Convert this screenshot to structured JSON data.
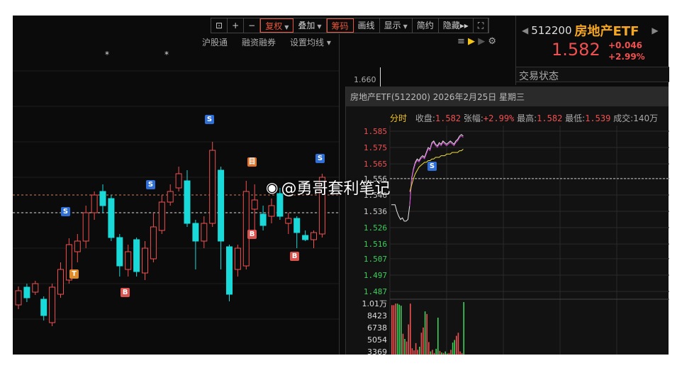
{
  "toolbar": {
    "items": [
      {
        "label": "复权",
        "red": true,
        "caret": true
      },
      {
        "label": "叠加",
        "caret": true
      },
      {
        "label": "筹码",
        "red": true
      },
      {
        "label": "画线"
      },
      {
        "label": "显示",
        "caret": true
      },
      {
        "label": "简约"
      },
      {
        "label": "隐藏▸▸"
      }
    ]
  },
  "subbar": [
    "沪股通",
    "融资融券",
    "设置均线 ▾"
  ],
  "stock": {
    "code": "512200",
    "name": "房地产ETF",
    "price": "1.582",
    "change": "+0.046",
    "change_pct": "+2.99%",
    "trade_status": "交易状态"
  },
  "left_axis_label": "1.660",
  "markers": {
    "s": "S",
    "b": "B",
    "t": "T",
    "m": "目",
    "star": "*"
  },
  "colors": {
    "up": "#f05050",
    "down": "#19d9d9",
    "bg": "#0b0b0b",
    "accent": "#f5a623"
  },
  "chart_data": [
    {
      "type": "candlestick",
      "title": "房地产ETF 日K",
      "ohlc": [
        [
          1.426,
          1.446,
          1.452,
          1.42
        ],
        [
          1.451,
          1.436,
          1.456,
          1.43
        ],
        [
          1.444,
          1.456,
          1.46,
          1.44
        ],
        [
          1.434,
          1.411,
          1.438,
          1.404
        ],
        [
          1.401,
          1.451,
          1.456,
          1.396
        ],
        [
          1.441,
          1.476,
          1.486,
          1.436
        ],
        [
          1.461,
          1.511,
          1.52,
          1.456
        ],
        [
          1.501,
          1.516,
          1.526,
          1.486
        ],
        [
          1.516,
          1.556,
          1.566,
          1.506
        ],
        [
          1.556,
          1.581,
          1.586,
          1.546
        ],
        [
          1.586,
          1.566,
          1.596,
          1.556
        ],
        [
          1.576,
          1.521,
          1.581,
          1.516
        ],
        [
          1.521,
          1.481,
          1.526,
          1.466
        ],
        [
          1.476,
          1.501,
          1.511,
          1.466
        ],
        [
          1.518,
          1.473,
          1.521,
          1.466
        ],
        [
          1.471,
          1.506,
          1.516,
          1.461
        ],
        [
          1.491,
          1.536,
          1.556,
          1.486
        ],
        [
          1.531,
          1.571,
          1.581,
          1.526
        ],
        [
          1.571,
          1.586,
          1.596,
          1.566
        ],
        [
          1.591,
          1.611,
          1.621,
          1.586
        ],
        [
          1.601,
          1.541,
          1.616,
          1.536
        ],
        [
          1.541,
          1.516,
          1.546,
          1.476
        ],
        [
          1.516,
          1.541,
          1.551,
          1.506
        ],
        [
          1.541,
          1.644,
          1.656,
          1.536
        ],
        [
          1.616,
          1.516,
          1.621,
          1.476
        ],
        [
          1.508,
          1.441,
          1.511,
          1.431
        ],
        [
          1.476,
          1.506,
          1.511,
          1.466
        ],
        [
          1.481,
          1.586,
          1.601,
          1.476
        ],
        [
          1.561,
          1.574,
          1.596,
          1.531
        ],
        [
          1.554,
          1.538,
          1.566,
          1.531
        ],
        [
          1.551,
          1.566,
          1.576,
          1.541
        ],
        [
          1.583,
          1.551,
          1.591,
          1.546
        ],
        [
          1.541,
          1.548,
          1.556,
          1.526
        ],
        [
          1.548,
          1.528,
          1.551,
          1.506
        ],
        [
          1.524,
          1.518,
          1.531,
          1.516
        ],
        [
          1.518,
          1.528,
          1.531,
          1.506
        ],
        [
          1.526,
          1.606,
          1.611,
          1.521
        ]
      ],
      "reference_lines": [
        1.556,
        1.581
      ]
    },
    {
      "type": "line",
      "title": "房地产ETF(512200) 2026年2月25日 星期三",
      "tab": "分时",
      "stats": {
        "close_label": "收盘",
        "close": "1.582",
        "chg_label": "张幅",
        "chg": "+2.99%",
        "high_label": "最高",
        "high": "1.582",
        "low_label": "最低",
        "low": "1.539",
        "vol_label": "成交",
        "vol": "140万"
      },
      "yticks": [
        "1.585",
        "1.575",
        "1.565",
        "1.556",
        "1.546",
        "1.536",
        "1.526",
        "1.516",
        "1.507",
        "1.497",
        "1.487"
      ],
      "ylim": [
        1.487,
        1.585
      ],
      "prev_close": 1.556,
      "price": [
        1.54,
        1.54,
        1.54,
        1.536,
        1.533,
        1.531,
        1.532,
        1.53,
        1.53,
        1.531,
        1.54,
        1.556,
        1.562,
        1.566,
        1.568,
        1.567,
        1.569,
        1.57,
        1.569,
        1.572,
        1.575,
        1.574,
        1.578,
        1.579,
        1.577,
        1.576,
        1.578,
        1.577,
        1.579,
        1.578,
        1.577,
        1.578,
        1.579,
        1.578,
        1.577,
        1.579,
        1.58,
        1.582,
        1.583,
        1.582
      ],
      "avg": [
        null,
        null,
        null,
        null,
        null,
        null,
        null,
        null,
        null,
        null,
        1.548,
        1.552,
        1.556,
        1.559,
        1.561,
        1.563,
        1.564,
        1.565,
        1.566,
        1.566,
        1.567,
        1.567,
        1.568,
        1.568,
        1.569,
        1.569,
        1.569,
        1.57,
        1.57,
        1.57,
        1.571,
        1.571,
        1.571,
        1.572,
        1.572,
        1.572,
        1.572,
        1.573,
        1.573,
        1.574
      ],
      "volume_ticks": [
        "1.01万",
        "8423",
        "6738",
        "5054",
        "3369"
      ],
      "volume": [
        9500,
        9500,
        9800,
        9800,
        9600,
        9400,
        4000,
        3000,
        2500,
        5800,
        9800,
        1200,
        800,
        2200,
        900,
        1500,
        4200,
        5200,
        8300,
        7800,
        2400,
        600,
        900,
        300,
        1100,
        7100,
        700,
        400,
        300,
        600,
        200,
        300,
        900,
        2300,
        2800,
        3600,
        4200,
        600,
        300,
        10100
      ]
    }
  ],
  "watermark": "@勇哥套利笔记"
}
